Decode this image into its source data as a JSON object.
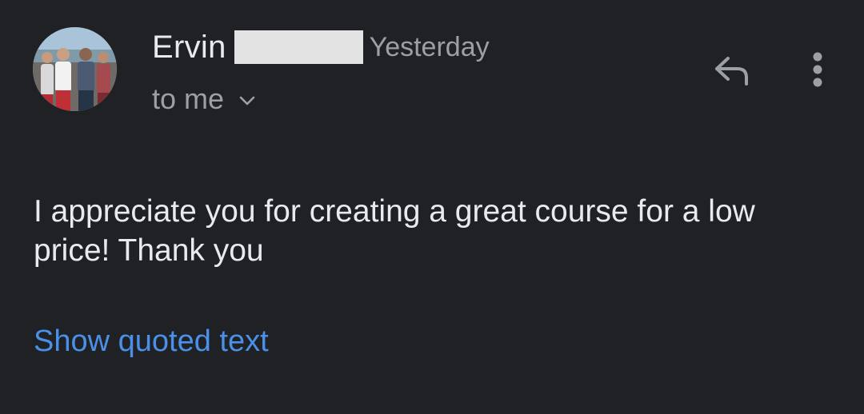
{
  "message": {
    "sender_name": "Ervin",
    "timestamp": "Yesterday",
    "recipient_label": "to me",
    "body": "I appreciate you for creating a great course for a low price! Thank you",
    "quoted_text_link": "Show quoted text"
  },
  "icons": {
    "reply": "reply-icon",
    "more": "more-vert-icon",
    "recipient_details": "chevron-down-icon"
  },
  "colors": {
    "background": "#202124",
    "primary_text": "#e8eaed",
    "secondary_text": "#9aa0a6",
    "link": "#4a90e8",
    "redaction": "#e3e3e3"
  }
}
